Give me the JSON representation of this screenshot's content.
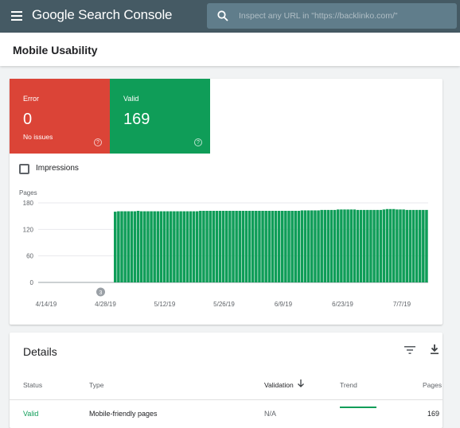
{
  "app": {
    "title": "Google Search Console",
    "brand_google": "Google",
    "brand_product": "Search Console"
  },
  "search": {
    "placeholder": "Inspect any URL in \"https://backlinko.com/\""
  },
  "page": {
    "title": "Mobile Usability"
  },
  "summary": {
    "error": {
      "label": "Error",
      "count": "0",
      "sub": "No issues",
      "color": "#db4437"
    },
    "valid": {
      "label": "Valid",
      "count": "169",
      "color": "#0f9d58"
    }
  },
  "impressions": {
    "label": "Impressions",
    "checked": false
  },
  "chart_data": {
    "type": "bar",
    "ylabel": "Pages",
    "ylim": [
      0,
      180
    ],
    "yticks": [
      "180",
      "120",
      "60",
      "0"
    ],
    "xticks": [
      "4/14/19",
      "4/28/19",
      "5/12/19",
      "5/26/19",
      "6/9/19",
      "6/23/19",
      "7/7/19"
    ],
    "annotation": "3",
    "series": [
      {
        "color": "#0f9d58",
        "values": [
          0,
          0,
          0,
          0,
          0,
          0,
          0,
          0,
          0,
          0,
          0,
          0,
          0,
          0,
          0,
          0,
          0,
          0,
          0,
          0,
          0,
          0,
          0,
          160,
          161,
          161,
          161,
          161,
          161,
          161,
          162,
          161,
          161,
          161,
          161,
          161,
          161,
          161,
          161,
          161,
          161,
          161,
          161,
          161,
          161,
          161,
          161,
          161,
          161,
          162,
          162,
          162,
          162,
          162,
          162,
          162,
          162,
          162,
          162,
          162,
          162,
          162,
          162,
          162,
          162,
          162,
          162,
          162,
          162,
          162,
          162,
          162,
          162,
          162,
          162,
          162,
          162,
          162,
          162,
          162,
          163,
          163,
          163,
          163,
          163,
          163,
          164,
          164,
          164,
          164,
          164,
          165,
          165,
          165,
          165,
          165,
          165,
          164,
          164,
          164,
          164,
          164,
          164,
          164,
          164,
          165,
          166,
          166,
          166,
          165,
          165,
          165,
          164,
          164,
          164,
          164,
          164,
          164,
          164
        ]
      }
    ]
  },
  "details": {
    "title": "Details",
    "columns": {
      "status": "Status",
      "type": "Type",
      "validation": "Validation",
      "trend": "Trend",
      "pages": "Pages"
    },
    "rows": [
      {
        "status": "Valid",
        "type": "Mobile-friendly pages",
        "validation": "N/A",
        "pages": "169"
      }
    ]
  }
}
